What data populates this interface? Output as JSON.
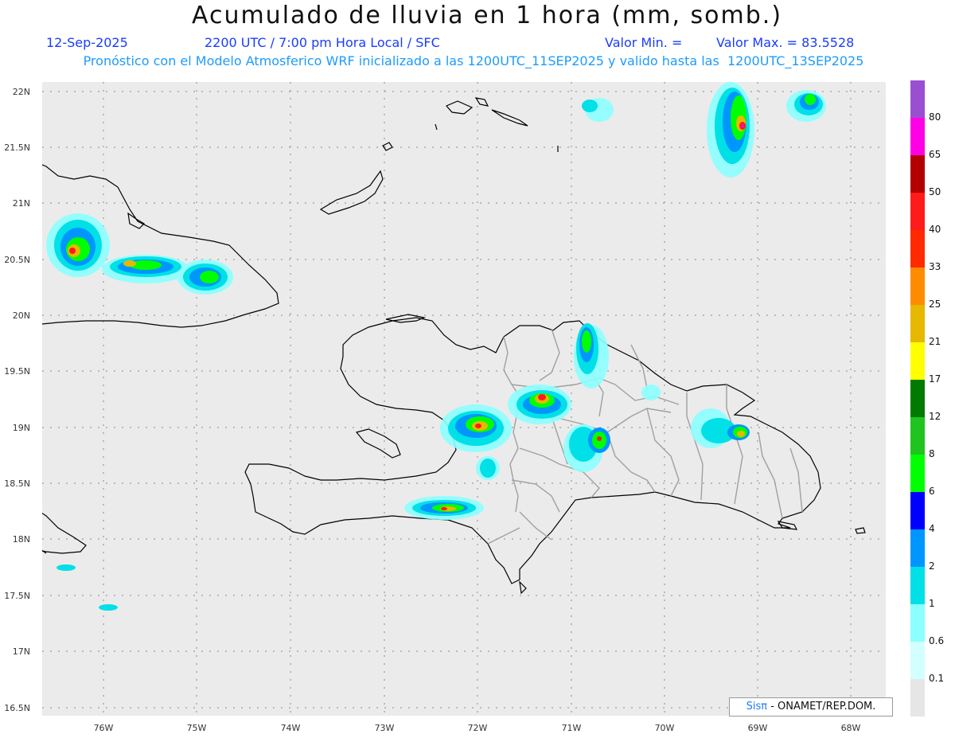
{
  "header": {
    "title": "Acumulado de lluvia en 1 hora (mm, somb.)",
    "date": "12-Sep-2025",
    "time_info": "2200 UTC / 7:00 pm Hora Local / SFC",
    "min_label": "Valor Min. =",
    "max_label": "Valor Max. = 83.5528",
    "model_info": "Pronóstico con el Modelo Atmosferico WRF inicializado a las 1200UTC_11SEP2025 y valido hasta las  1200UTC_13SEP2025"
  },
  "axes": {
    "lat_labels": [
      "22N",
      "21.5N",
      "21N",
      "20.5N",
      "20N",
      "19.5N",
      "19N",
      "18.5N",
      "18N",
      "17.5N",
      "17N",
      "16.5N"
    ],
    "lon_labels": [
      "76W",
      "75W",
      "74W",
      "73W",
      "72W",
      "71W",
      "70W",
      "69W",
      "68W"
    ]
  },
  "colorbar": {
    "labels": [
      "80",
      "65",
      "50",
      "40",
      "33",
      "25",
      "21",
      "17",
      "12",
      "8",
      "6",
      "4",
      "2",
      "1",
      "0.6",
      "0.1"
    ],
    "colors": [
      "#9a4fd0",
      "#ff00e6",
      "#b30000",
      "#ff1b1b",
      "#ff2a00",
      "#ff8c00",
      "#e6b800",
      "#ffff00",
      "#007a00",
      "#1fc41f",
      "#00ff00",
      "#0000ff",
      "#0096ff",
      "#00e0e6",
      "#8cffff",
      "#d2ffff",
      "#e6e6e6"
    ]
  },
  "credit": {
    "brand": "Sisπ",
    "org": " - ONAMET/REP.DOM."
  }
}
